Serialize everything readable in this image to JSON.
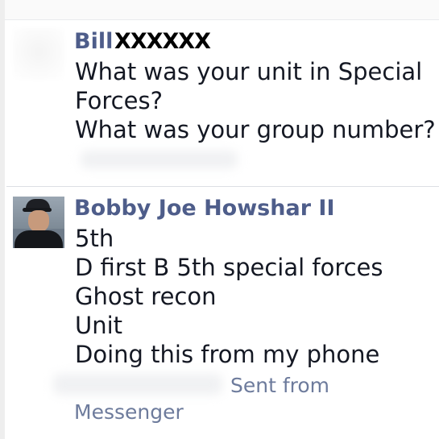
{
  "thread": {
    "messages": [
      {
        "sender_first": "Bill",
        "sender_redaction": "XXXXXX",
        "lines": [
          "What was your unit in Special",
          "Forces?",
          "What was your group number?"
        ]
      },
      {
        "sender": "Bobby Joe Howshar II",
        "lines": [
          "5th",
          "D first B 5th special forces",
          "Ghost recon",
          "Unit",
          "Doing this from my phone"
        ],
        "meta_sent": "Sent from",
        "meta_app": "Messenger"
      }
    ]
  },
  "colors": {
    "sender_name": "#4e5d8a",
    "body_text": "#141823",
    "meta_text": "#6d7b9c"
  }
}
